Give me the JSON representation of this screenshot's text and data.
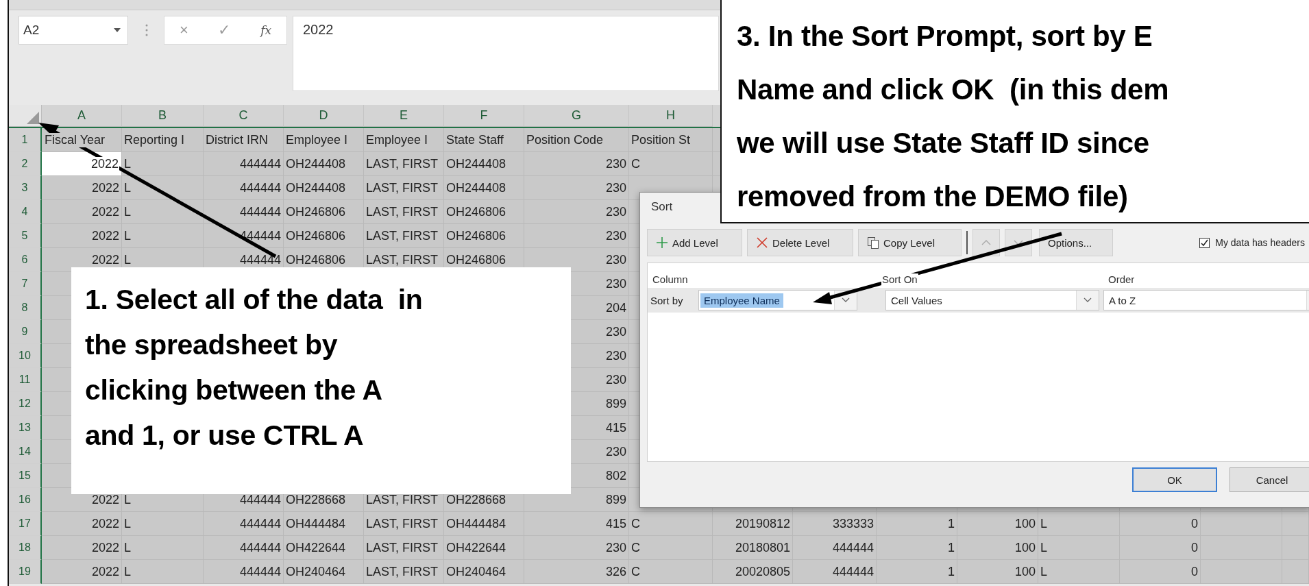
{
  "formula_bar": {
    "name_box": "A2",
    "cancel_symbol": "×",
    "enter_symbol": "✓",
    "function_symbol": "fx",
    "value": "2022"
  },
  "sheet": {
    "all_selected": true,
    "columns": [
      "A",
      "B",
      "C",
      "D",
      "E",
      "F",
      "G",
      "H"
    ],
    "rows": [
      {
        "number": "1",
        "kind": "heading",
        "active": false,
        "cells": {
          "A": "Fiscal Year",
          "B": "Reporting I",
          "C": "District IRN",
          "D": "Employee I",
          "E": "Employee I",
          "F": "State Staff",
          "G": "Position Code",
          "H": "Position St"
        }
      },
      {
        "number": "2",
        "kind": "data",
        "active": true,
        "cells": {
          "A": "2022",
          "B": "L",
          "C": "444444",
          "D": "OH244408",
          "E": "LAST, FIRST",
          "F": "OH244408",
          "G": "230",
          "H": "C"
        }
      },
      {
        "number": "3",
        "kind": "data",
        "active": false,
        "cells": {
          "A": "2022",
          "B": "L",
          "C": "444444",
          "D": "OH244408",
          "E": "LAST, FIRST",
          "F": "OH244408",
          "G": "230"
        }
      },
      {
        "number": "4",
        "kind": "data",
        "active": false,
        "cells": {
          "A": "2022",
          "B": "L",
          "C": "444444",
          "D": "OH246806",
          "E": "LAST, FIRST",
          "F": "OH246806",
          "G": "230"
        }
      },
      {
        "number": "5",
        "kind": "data",
        "active": false,
        "cells": {
          "A": "2022",
          "B": "L",
          "C": "444444",
          "D": "OH246806",
          "E": "LAST, FIRST",
          "F": "OH246806",
          "G": "230"
        }
      },
      {
        "number": "6",
        "kind": "data",
        "active": false,
        "cells": {
          "A": "2022",
          "B": "L",
          "C": "444444",
          "D": "OH246806",
          "E": "LAST, FIRST",
          "F": "OH246806",
          "G": "230"
        }
      },
      {
        "number": "7",
        "kind": "data",
        "active": false,
        "cells": {
          "G": "230"
        }
      },
      {
        "number": "8",
        "kind": "data",
        "active": false,
        "cells": {
          "G": "204"
        }
      },
      {
        "number": "9",
        "kind": "data",
        "active": false,
        "cells": {
          "G": "230"
        }
      },
      {
        "number": "10",
        "kind": "data",
        "active": false,
        "cells": {
          "G": "230"
        }
      },
      {
        "number": "11",
        "kind": "data",
        "active": false,
        "cells": {
          "G": "230"
        }
      },
      {
        "number": "12",
        "kind": "data",
        "active": false,
        "cells": {
          "G": "899"
        }
      },
      {
        "number": "13",
        "kind": "data",
        "active": false,
        "cells": {
          "G": "415"
        }
      },
      {
        "number": "14",
        "kind": "data",
        "active": false,
        "cells": {
          "G": "230"
        }
      },
      {
        "number": "15",
        "kind": "data",
        "active": false,
        "cells": {
          "G": "802"
        }
      },
      {
        "number": "16",
        "kind": "data",
        "active": false,
        "cells": {
          "A": "2022",
          "B": "L",
          "C": "444444",
          "D": "OH228668",
          "E": "LAST, FIRST",
          "F": "OH228668",
          "G": "899"
        }
      },
      {
        "number": "17",
        "kind": "data",
        "active": false,
        "cells": {
          "A": "2022",
          "B": "L",
          "C": "444444",
          "D": "OH444484",
          "E": "LAST, FIRST",
          "F": "OH444484",
          "G": "415",
          "H": "C",
          "I": "20190812",
          "J": "333333",
          "K": "1",
          "L": "100",
          "M": "L",
          "N": "0"
        }
      },
      {
        "number": "18",
        "kind": "data",
        "active": false,
        "cells": {
          "A": "2022",
          "B": "L",
          "C": "444444",
          "D": "OH422644",
          "E": "LAST, FIRST",
          "F": "OH422644",
          "G": "230",
          "H": "C",
          "I": "20180801",
          "J": "444444",
          "K": "1",
          "L": "100",
          "M": "L",
          "N": "0"
        }
      },
      {
        "number": "19",
        "kind": "data",
        "active": false,
        "cells": {
          "A": "2022",
          "B": "L",
          "C": "444444",
          "D": "OH240464",
          "E": "LAST, FIRST",
          "F": "OH240464",
          "G": "326",
          "H": "C",
          "I": "20020805",
          "J": "444444",
          "K": "1",
          "L": "100",
          "M": "L",
          "N": "0"
        }
      }
    ]
  },
  "sort_dialog": {
    "title": "Sort",
    "toolbar": [
      {
        "kind": "add",
        "label": "Add Level",
        "disabled": false
      },
      {
        "kind": "delete",
        "label": "Delete Level",
        "disabled": false
      },
      {
        "kind": "copy",
        "label": "Copy Level",
        "disabled": false
      },
      {
        "kind": "move_up",
        "disabled": true
      },
      {
        "kind": "move_down",
        "disabled": true
      },
      {
        "kind": "options",
        "label": "Options...",
        "disabled": false
      }
    ],
    "headers_checkbox": {
      "label": "My data has headers",
      "checked": true
    },
    "column_headings": [
      "Column",
      "Sort On",
      "Order"
    ],
    "levels": [
      {
        "label": "Sort by",
        "column": "Employee Name",
        "sort_on": "Cell Values",
        "order": "A to Z",
        "selected": true
      }
    ],
    "buttons": [
      {
        "label": "OK",
        "default": true
      },
      {
        "label": "Cancel",
        "default": false
      }
    ]
  },
  "callouts": [
    {
      "kind": "lower_left",
      "text": "1. Select all of the data  in\nthe spreadsheet by\nclicking between the A\nand 1, or use CTRL A"
    },
    {
      "kind": "upper_right",
      "text": "3. In the Sort Prompt, sort by E\nName and click OK  (in this dem\nwe will use State Staff ID since\nremoved from the DEMO file)"
    }
  ]
}
